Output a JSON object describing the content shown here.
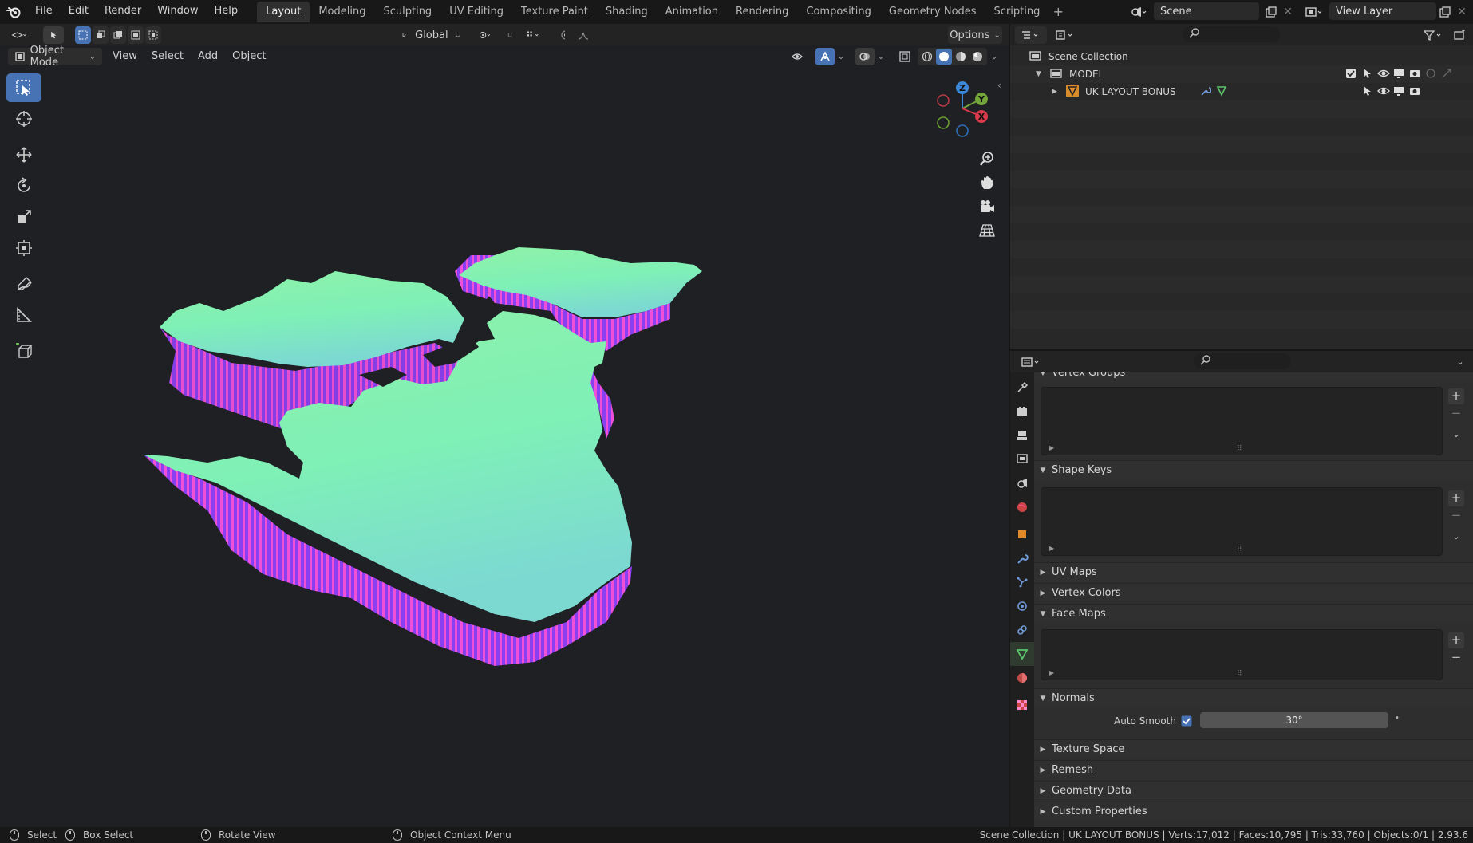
{
  "menus": [
    "File",
    "Edit",
    "Render",
    "Window",
    "Help"
  ],
  "workspace_tabs": [
    {
      "label": "Layout",
      "active": true
    },
    {
      "label": "Modeling",
      "active": false
    },
    {
      "label": "Sculpting",
      "active": false
    },
    {
      "label": "UV Editing",
      "active": false
    },
    {
      "label": "Texture Paint",
      "active": false
    },
    {
      "label": "Shading",
      "active": false
    },
    {
      "label": "Animation",
      "active": false
    },
    {
      "label": "Rendering",
      "active": false
    },
    {
      "label": "Compositing",
      "active": false
    },
    {
      "label": "Geometry Nodes",
      "active": false
    },
    {
      "label": "Scripting",
      "active": false
    }
  ],
  "tab_add": "+",
  "scene": {
    "label": "Scene"
  },
  "view_layer": {
    "label": "View Layer"
  },
  "viewport": {
    "transform_orientation": "Global",
    "options_label": "Options",
    "mode": "Object Mode",
    "menus": [
      "View",
      "Select",
      "Add",
      "Object"
    ],
    "gizmo_labels": {
      "z": "Z",
      "y": "Y",
      "x": "X"
    },
    "map_colors": {
      "top": "#7ff0b6",
      "top_far": "#8ff2a8",
      "top_near": "#7cd9d2",
      "side_a": "#8a3ff0",
      "side_b": "#f04fd8"
    }
  },
  "outliner": {
    "search_placeholder": "",
    "items": [
      {
        "label": "Scene Collection",
        "level": 0
      },
      {
        "label": "MODEL",
        "level": 1
      },
      {
        "label": "UK LAYOUT BONUS",
        "level": 2
      }
    ]
  },
  "properties": {
    "search_placeholder": "",
    "sections": {
      "vertex_groups": "Vertex Groups",
      "shape_keys": "Shape Keys",
      "uv_maps": "UV Maps",
      "vertex_colors": "Vertex Colors",
      "face_maps": "Face Maps",
      "normals": "Normals",
      "texture_space": "Texture Space",
      "remesh": "Remesh",
      "geometry_data": "Geometry Data",
      "custom_properties": "Custom Properties"
    },
    "auto_smooth_label": "Auto Smooth",
    "auto_smooth_checked": true,
    "auto_smooth_angle": "30°"
  },
  "status": {
    "select": "Select",
    "box_select": "Box Select",
    "rotate_view": "Rotate View",
    "context_menu": "Object Context Menu",
    "stats": "Scene Collection | UK LAYOUT BONUS | Verts:17,012 | Faces:10,795 | Tris:33,760 | Objects:0/1 | 2.93.6"
  }
}
